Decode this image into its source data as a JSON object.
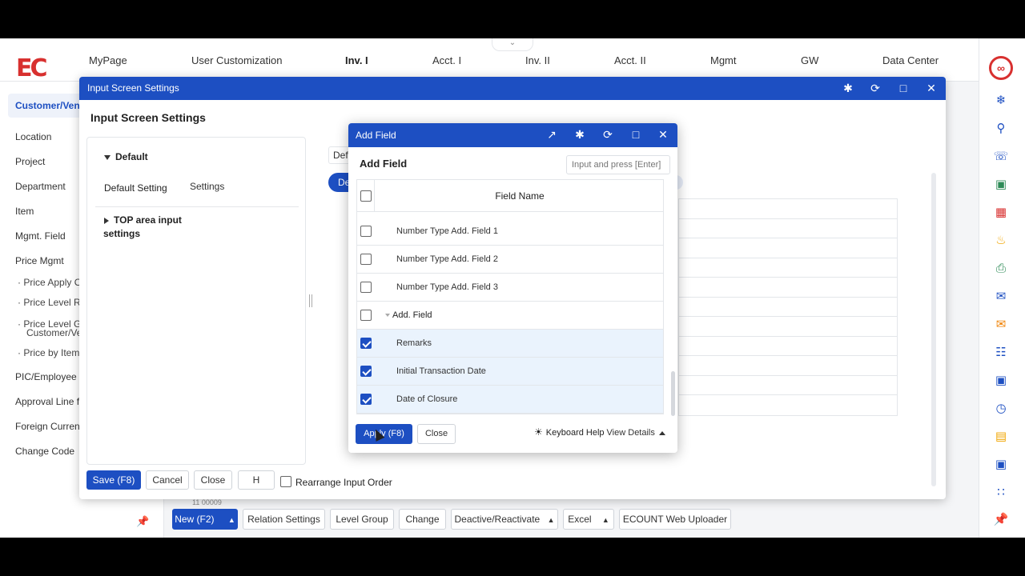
{
  "colors": {
    "accent": "#1d4fc2",
    "brand": "#d8302f",
    "selected_row": "#eaf3fd"
  },
  "topnav": {
    "logo_text": "EC",
    "items": [
      {
        "label": "MyPage"
      },
      {
        "label": "User Customization"
      },
      {
        "label": "Inv. I"
      },
      {
        "label": "Acct. I"
      },
      {
        "label": "Inv. II"
      },
      {
        "label": "Acct. II"
      },
      {
        "label": "Mgmt"
      },
      {
        "label": "GW"
      },
      {
        "label": "Data Center"
      }
    ],
    "active": "Inv. I"
  },
  "leftnav": {
    "items": [
      {
        "label": "Customer/Vendor"
      },
      {
        "label": "Location"
      },
      {
        "label": "Project"
      },
      {
        "label": "Department"
      },
      {
        "label": "Item"
      },
      {
        "label": "Mgmt. Field"
      },
      {
        "label": "Price Mgmt"
      },
      {
        "label": "PIC/Employee"
      },
      {
        "label": "Approval Line fo"
      },
      {
        "label": "Foreign Currenc"
      },
      {
        "label": "Change Code"
      }
    ],
    "subs": [
      {
        "label": "· Price Apply O"
      },
      {
        "label": "· Price Level R"
      },
      {
        "label": "· Price Level G"
      },
      {
        "label": "Customer/Ver"
      },
      {
        "label": "· Price by Item"
      }
    ]
  },
  "bottombar": {
    "row_text": "11  00009",
    "new_label": "New (F2)",
    "relation_label": "Relation Settings",
    "level_group_label": "Level Group",
    "change_label": "Change",
    "deactivate_label": "Deactive/Reactivate",
    "excel_label": "Excel",
    "uploader_label": "ECOUNT Web Uploader"
  },
  "input_settings": {
    "window_title": "Input Screen Settings",
    "heading": "Input Screen Settings",
    "tree": {
      "default_label": "Default",
      "default_setting_label": "Default Setting",
      "settings_label": "Settings",
      "top_area_label_1": "TOP area input",
      "top_area_label_2": "settings"
    },
    "peek_select": "Def",
    "peek_pill": "De",
    "footer": {
      "save_label": "Save (F8)",
      "cancel_label": "Cancel",
      "close_label": "Close",
      "h_label": "H",
      "rearrange_label": "Rearrange Input Order"
    }
  },
  "add_field": {
    "window_title": "Add Field",
    "heading": "Add Field",
    "search_placeholder": "Input and press [Enter]",
    "column_header": "Field Name",
    "rows": [
      {
        "label": "Number Type Add. Field 1",
        "checked": false,
        "group": false
      },
      {
        "label": "Number Type Add. Field 2",
        "checked": false,
        "group": false
      },
      {
        "label": "Number Type Add. Field 3",
        "checked": false,
        "group": false
      },
      {
        "label": "Add. Field",
        "checked": false,
        "group": true
      },
      {
        "label": "Remarks",
        "checked": true,
        "group": false
      },
      {
        "label": "Initial Transaction Date",
        "checked": true,
        "group": false
      },
      {
        "label": "Date of Closure",
        "checked": true,
        "group": false
      }
    ],
    "apply_label": "Apply (F8)",
    "close_label": "Close",
    "keyboard_help_label": "Keyboard Help",
    "view_details_label": "View Details"
  }
}
